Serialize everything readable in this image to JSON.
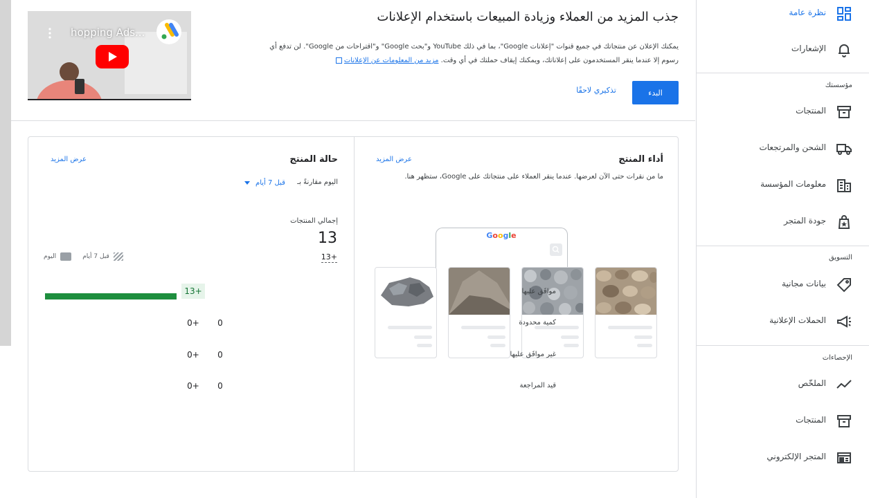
{
  "sidebar": {
    "top_items": [
      {
        "label": "نظرة عامة",
        "icon": "dashboard-icon",
        "active": true
      },
      {
        "label": "الإشعارات",
        "icon": "bell-icon"
      }
    ],
    "sections": [
      {
        "title": "مؤسستك",
        "items": [
          {
            "label": "المنتجات",
            "icon": "archive-box-icon"
          },
          {
            "label": "الشحن والمرتجعات",
            "icon": "truck-icon"
          },
          {
            "label": "معلومات المؤسسة",
            "icon": "building-icon"
          },
          {
            "label": "جودة المتجر",
            "icon": "store-quality-icon"
          }
        ]
      },
      {
        "title": "التسويق",
        "items": [
          {
            "label": "بيانات مجانية",
            "icon": "tag-icon"
          },
          {
            "label": "الحملات الإعلانية",
            "icon": "megaphone-icon"
          }
        ]
      },
      {
        "title": "الإحصاءات",
        "items": [
          {
            "label": "الملخّص",
            "icon": "trend-line-icon"
          },
          {
            "label": "المنتجات",
            "icon": "archive-box-icon"
          },
          {
            "label": "المتجر الإلكتروني",
            "icon": "web-store-icon"
          }
        ]
      }
    ]
  },
  "promo": {
    "video_title": "...hopping Ads",
    "title": "جذب المزيد من العملاء وزيادة المبيعات باستخدام الإعلانات",
    "description_1": "يمكنك الإعلان عن منتجاتك في جميع قنوات \"إعلانات Google\"، بما في ذلك YouTube و\"بحث Google\" و\"اقتراحات من Google\". لن تدفع أي",
    "description_2": "رسوم إلا عندما ينقر المستخدمون على إعلاناتك، ويمكنك إيقاف حملتك في أي وقت.",
    "learn_more": "مزيد من المعلومات عن الإعلانات",
    "start_button": "البدء",
    "remind_button": "تذكيري لاحقًا"
  },
  "performance": {
    "title": "أداء المنتج",
    "see_more": "عرض المزيد",
    "description": "ما من نقرات حتى الآن لعرضها. عندما ينقر العملاء على منتجاتك على Google، ستظهر هنا.",
    "google_logo": "Google"
  },
  "status": {
    "title": "حالة المنتج",
    "see_more": "عرض المزيد",
    "compare_label": "اليوم مقارنةً بـ",
    "compare_value": "قبل 7 أيام",
    "total_label": "إجمالي المنتجات",
    "total_value": "13",
    "total_delta": "+13",
    "legend_today": "اليوم",
    "legend_7days": "قبل 7 أيام",
    "rows": [
      {
        "label": "موافَق عليها",
        "value": "13",
        "delta": "+13",
        "progress": 1.0
      },
      {
        "label": "كمية محدودة",
        "value": "0",
        "delta": "+0"
      },
      {
        "label": "غير موافَق عليها",
        "value": "0",
        "delta": "+0"
      },
      {
        "label": "قيد المراجعة",
        "value": "0",
        "delta": "+0"
      }
    ]
  },
  "colors": {
    "accent": "#1a73e8",
    "success": "#1e8e3e"
  }
}
